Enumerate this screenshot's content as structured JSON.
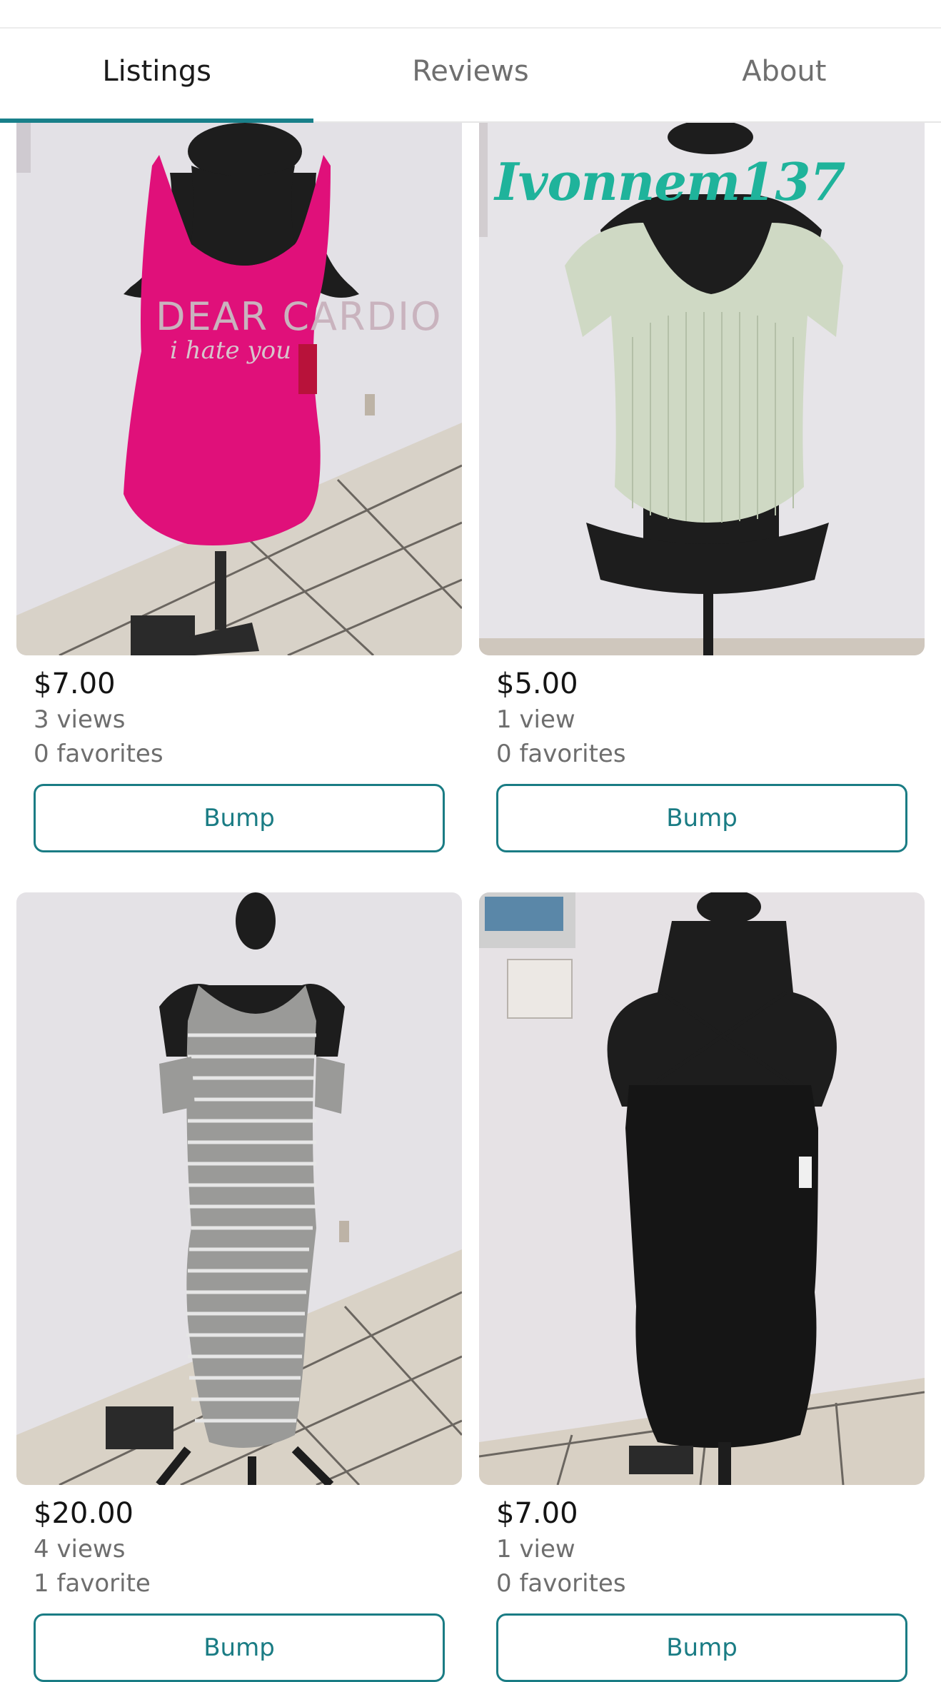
{
  "tabs": [
    {
      "label": "Listings",
      "active": true
    },
    {
      "label": "Reviews",
      "active": false
    },
    {
      "label": "About",
      "active": false
    }
  ],
  "colors": {
    "accent": "#19808a",
    "watermark": "#1fb39b"
  },
  "listings": [
    {
      "image": "pink tank top on dress form",
      "price": "$7.00",
      "views": "3 views",
      "favorites": "0 favorites",
      "button": "Bump",
      "tank_print_line1": "DEAR CARDIO",
      "tank_print_line2": "i hate you"
    },
    {
      "image": "sage ribbed short-sleeve sweater on dress form",
      "watermark": "Ivonnem137",
      "price": "$5.00",
      "views": "1 view",
      "favorites": "0 favorites",
      "button": "Bump"
    },
    {
      "image": "gray and white striped cold-shoulder maxi dress on dress form",
      "price": "$20.00",
      "views": "4 views",
      "favorites": "1 favorite",
      "button": "Bump"
    },
    {
      "image": "black cross-strap slip dress on dress form",
      "price": "$7.00",
      "views": "1 view",
      "favorites": "0 favorites",
      "button": "Bump"
    }
  ]
}
